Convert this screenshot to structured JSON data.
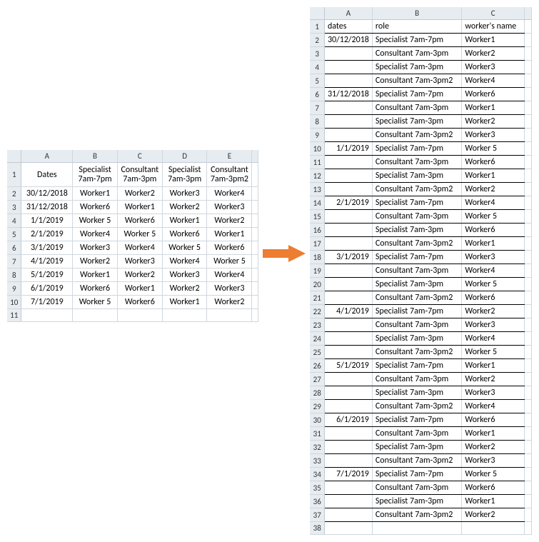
{
  "leftTable": {
    "colHeaders": [
      "A",
      "B",
      "C",
      "D",
      "E"
    ],
    "rowHeaders": [
      "1",
      "2",
      "3",
      "4",
      "5",
      "6",
      "7",
      "8",
      "9",
      "10",
      "11"
    ],
    "header": {
      "dates": "Dates",
      "roles": [
        "Specialist 7am-7pm",
        "Consultant 7am-3pm",
        "Specialist 7am-3pm",
        "Consultant 7am-3pm2"
      ]
    },
    "rows": [
      {
        "date": "30/12/2018",
        "vals": [
          "Worker1",
          "Worker2",
          "Worker3",
          "Worker4"
        ]
      },
      {
        "date": "31/12/2018",
        "vals": [
          "Worker6",
          "Worker1",
          "Worker2",
          "Worker3"
        ]
      },
      {
        "date": "1/1/2019",
        "vals": [
          "Worker 5",
          "Worker6",
          "Worker1",
          "Worker2"
        ]
      },
      {
        "date": "2/1/2019",
        "vals": [
          "Worker4",
          "Worker 5",
          "Worker6",
          "Worker1"
        ]
      },
      {
        "date": "3/1/2019",
        "vals": [
          "Worker3",
          "Worker4",
          "Worker 5",
          "Worker6"
        ]
      },
      {
        "date": "4/1/2019",
        "vals": [
          "Worker2",
          "Worker3",
          "Worker4",
          "Worker 5"
        ]
      },
      {
        "date": "5/1/2019",
        "vals": [
          "Worker1",
          "Worker2",
          "Worker3",
          "Worker4"
        ]
      },
      {
        "date": "6/1/2019",
        "vals": [
          "Worker6",
          "Worker1",
          "Worker2",
          "Worker3"
        ]
      },
      {
        "date": "7/1/2019",
        "vals": [
          "Worker 5",
          "Worker6",
          "Worker1",
          "Worker2"
        ]
      }
    ]
  },
  "rightTable": {
    "colHeaders": [
      "A",
      "B",
      "C"
    ],
    "rowHeaders": [
      "1",
      "2",
      "3",
      "4",
      "5",
      "6",
      "7",
      "8",
      "9",
      "10",
      "11",
      "12",
      "13",
      "14",
      "15",
      "16",
      "17",
      "18",
      "19",
      "20",
      "21",
      "22",
      "23",
      "24",
      "25",
      "26",
      "27",
      "28",
      "29",
      "30",
      "31",
      "32",
      "33",
      "34",
      "35",
      "36",
      "37",
      "38"
    ],
    "header": {
      "dates": "dates",
      "role": "role",
      "name": "worker's name"
    },
    "rows": [
      {
        "date": "30/12/2018",
        "role": "Specialist 7am-7pm",
        "name": "Worker1"
      },
      {
        "date": "",
        "role": "Consultant 7am-3pm",
        "name": "Worker2"
      },
      {
        "date": "",
        "role": "Specialist 7am-3pm",
        "name": "Worker3"
      },
      {
        "date": "",
        "role": "Consultant 7am-3pm2",
        "name": "Worker4"
      },
      {
        "date": "31/12/2018",
        "role": "Specialist 7am-7pm",
        "name": "Worker6"
      },
      {
        "date": "",
        "role": "Consultant 7am-3pm",
        "name": "Worker1"
      },
      {
        "date": "",
        "role": "Specialist 7am-3pm",
        "name": "Worker2"
      },
      {
        "date": "",
        "role": "Consultant 7am-3pm2",
        "name": "Worker3"
      },
      {
        "date": "1/1/2019",
        "role": "Specialist 7am-7pm",
        "name": "Worker 5"
      },
      {
        "date": "",
        "role": "Consultant 7am-3pm",
        "name": "Worker6"
      },
      {
        "date": "",
        "role": "Specialist 7am-3pm",
        "name": "Worker1"
      },
      {
        "date": "",
        "role": "Consultant 7am-3pm2",
        "name": "Worker2"
      },
      {
        "date": "2/1/2019",
        "role": "Specialist 7am-7pm",
        "name": "Worker4"
      },
      {
        "date": "",
        "role": "Consultant 7am-3pm",
        "name": "Worker 5"
      },
      {
        "date": "",
        "role": "Specialist 7am-3pm",
        "name": "Worker6"
      },
      {
        "date": "",
        "role": "Consultant 7am-3pm2",
        "name": "Worker1"
      },
      {
        "date": "3/1/2019",
        "role": "Specialist 7am-7pm",
        "name": "Worker3"
      },
      {
        "date": "",
        "role": "Consultant 7am-3pm",
        "name": "Worker4"
      },
      {
        "date": "",
        "role": "Specialist 7am-3pm",
        "name": "Worker 5"
      },
      {
        "date": "",
        "role": "Consultant 7am-3pm2",
        "name": "Worker6"
      },
      {
        "date": "4/1/2019",
        "role": "Specialist 7am-7pm",
        "name": "Worker2"
      },
      {
        "date": "",
        "role": "Consultant 7am-3pm",
        "name": "Worker3"
      },
      {
        "date": "",
        "role": "Specialist 7am-3pm",
        "name": "Worker4"
      },
      {
        "date": "",
        "role": "Consultant 7am-3pm2",
        "name": "Worker 5"
      },
      {
        "date": "5/1/2019",
        "role": "Specialist 7am-7pm",
        "name": "Worker1"
      },
      {
        "date": "",
        "role": "Consultant 7am-3pm",
        "name": "Worker2"
      },
      {
        "date": "",
        "role": "Specialist 7am-3pm",
        "name": "Worker3"
      },
      {
        "date": "",
        "role": "Consultant 7am-3pm2",
        "name": "Worker4"
      },
      {
        "date": "6/1/2019",
        "role": "Specialist 7am-7pm",
        "name": "Worker6"
      },
      {
        "date": "",
        "role": "Consultant 7am-3pm",
        "name": "Worker1"
      },
      {
        "date": "",
        "role": "Specialist 7am-3pm",
        "name": "Worker2"
      },
      {
        "date": "",
        "role": "Consultant 7am-3pm2",
        "name": "Worker3"
      },
      {
        "date": "7/1/2019",
        "role": "Specialist 7am-7pm",
        "name": "Worker 5"
      },
      {
        "date": "",
        "role": "Consultant 7am-3pm",
        "name": "Worker6"
      },
      {
        "date": "",
        "role": "Specialist 7am-3pm",
        "name": "Worker1"
      },
      {
        "date": "",
        "role": "Consultant 7am-3pm2",
        "name": "Worker2"
      }
    ]
  },
  "colors": {
    "arrow": "#ED7D31"
  }
}
